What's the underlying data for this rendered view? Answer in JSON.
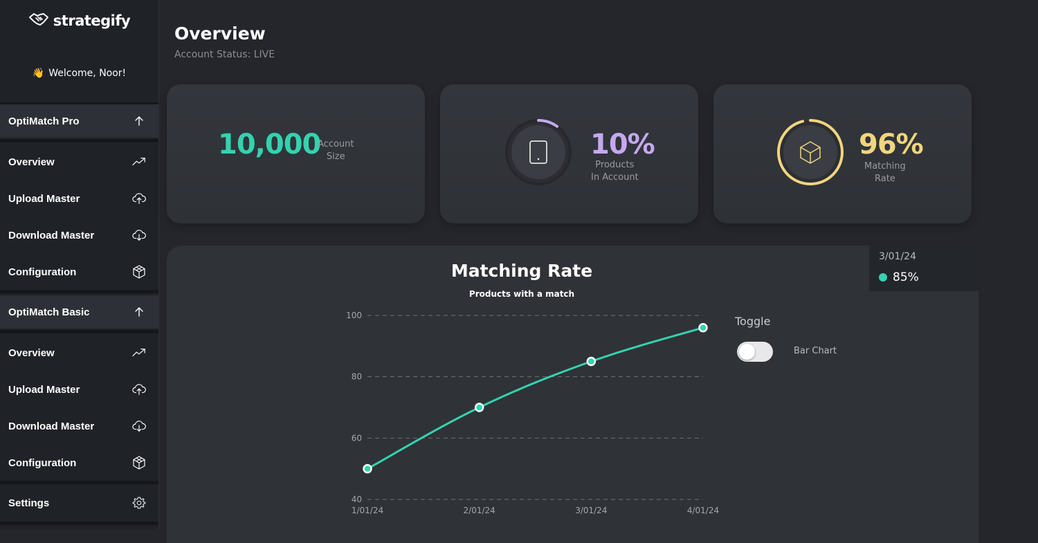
{
  "brand": {
    "name": "strategify"
  },
  "welcome": {
    "emoji": "👋",
    "text": "Welcome, Noor!"
  },
  "sidebar": {
    "sections": [
      {
        "label": "OptiMatch Pro",
        "items": [
          {
            "label": "Overview",
            "icon": "trending-up-icon"
          },
          {
            "label": "Upload Master",
            "icon": "cloud-upload-icon"
          },
          {
            "label": "Download Master",
            "icon": "cloud-download-icon"
          },
          {
            "label": "Configuration",
            "icon": "cube-icon"
          }
        ]
      },
      {
        "label": "OptiMatch Basic",
        "items": [
          {
            "label": "Overview",
            "icon": "trending-up-icon"
          },
          {
            "label": "Upload Master",
            "icon": "cloud-upload-icon"
          },
          {
            "label": "Download Master",
            "icon": "cloud-download-icon"
          },
          {
            "label": "Configuration",
            "icon": "cube-icon"
          }
        ]
      }
    ],
    "settings": {
      "label": "Settings",
      "icon": "gear-icon"
    }
  },
  "header": {
    "title": "Overview",
    "status": "Account Status: LIVE"
  },
  "stats": [
    {
      "value": "10,000",
      "label": "Account\nSize",
      "color": "#32d3b0"
    },
    {
      "value": "10%",
      "label": "Products\nIn Account",
      "color": "#c6a8f0",
      "progress": 0.1,
      "icon": "tablet-icon"
    },
    {
      "value": "96%",
      "label": "Matching\nRate",
      "color": "#f2d57e",
      "progress": 0.96,
      "icon": "box-icon"
    }
  ],
  "chart_data": {
    "type": "line",
    "title": "Matching Rate",
    "subtitle": "Products with a match",
    "categories": [
      "1/01/24",
      "2/01/24",
      "3/01/24",
      "4/01/24"
    ],
    "values": [
      50,
      70,
      85,
      96
    ],
    "ylim": [
      40,
      100
    ],
    "yticks": [
      40,
      60,
      80,
      100
    ],
    "grid": true,
    "line_color": "#32d3b0"
  },
  "tooltip": {
    "date": "3/01/24",
    "value": "85%"
  },
  "toggle": {
    "title": "Toggle",
    "label": "Bar Chart",
    "on": false
  }
}
